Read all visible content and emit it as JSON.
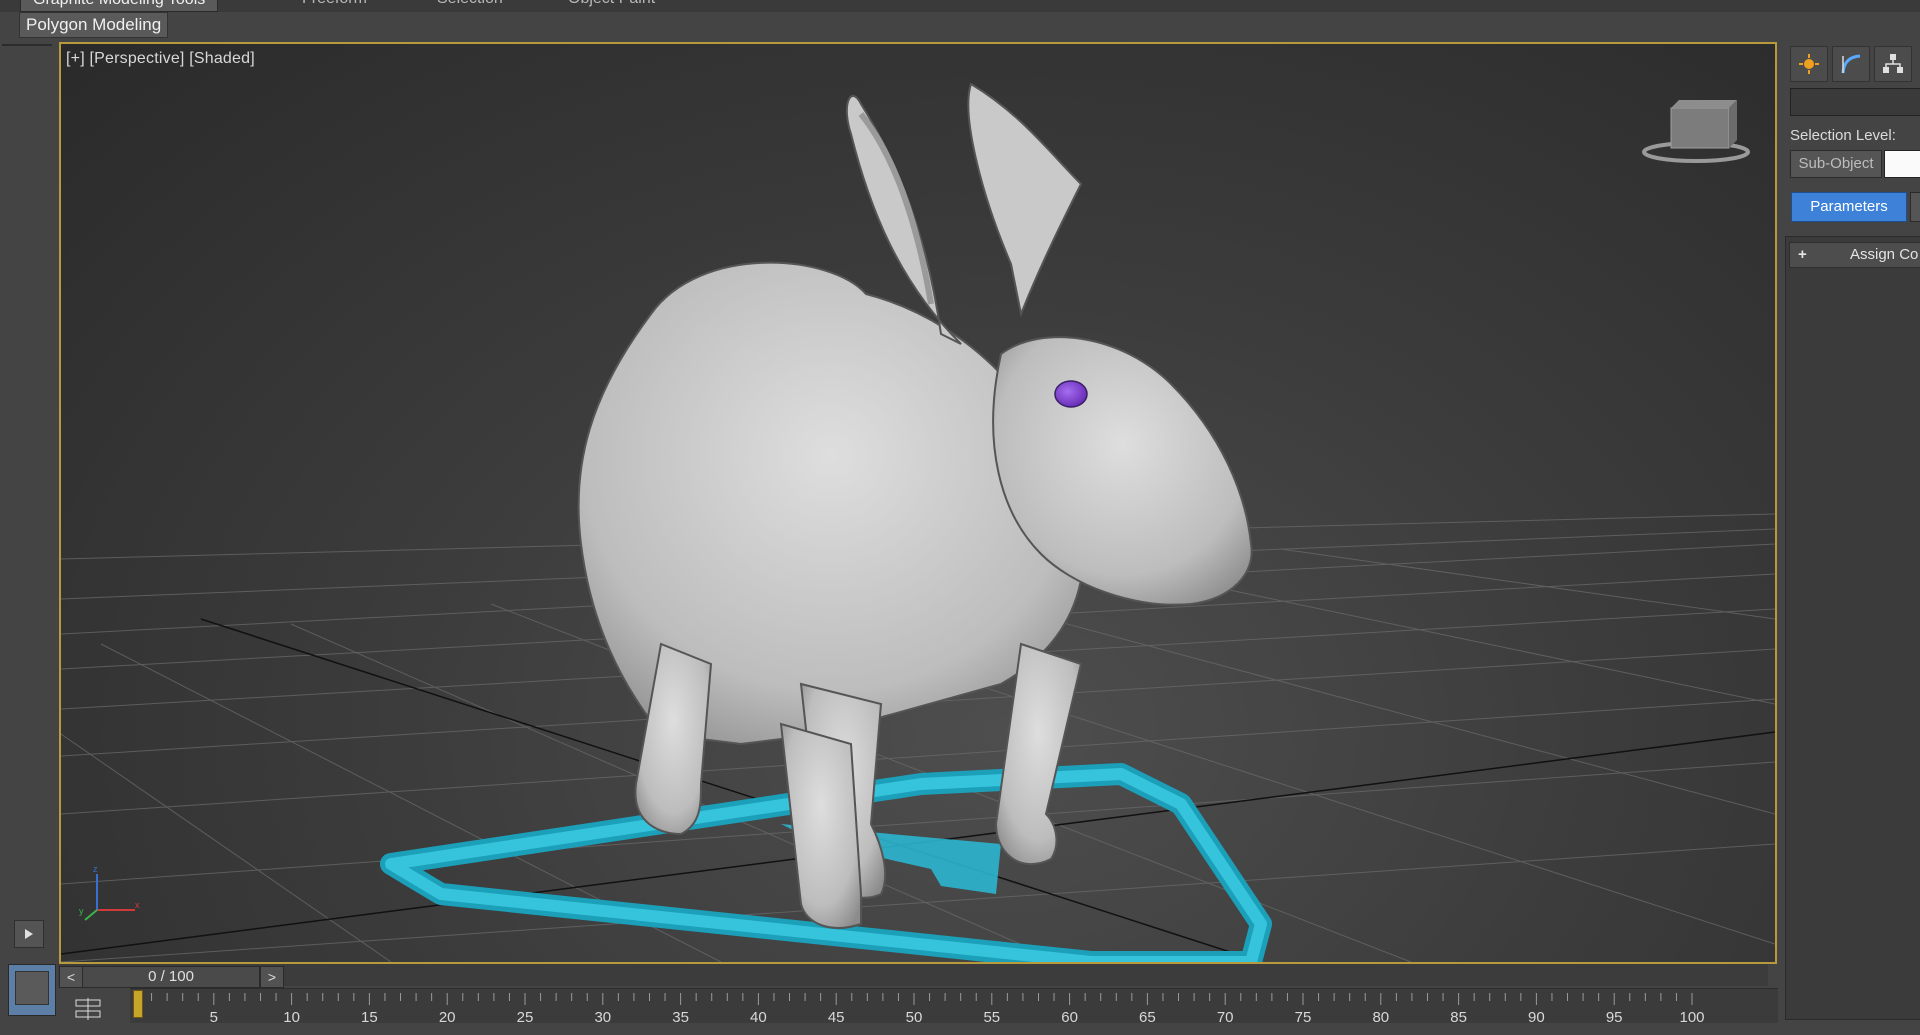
{
  "ribbon": {
    "tabs": [
      {
        "label": "Graphite Modeling Tools",
        "active": true
      },
      {
        "label": "Freeform",
        "active": false
      },
      {
        "label": "Selection",
        "active": false
      },
      {
        "label": "Object Paint",
        "active": false
      }
    ],
    "panel_label": "Polygon Modeling"
  },
  "viewport": {
    "label": "[+] [Perspective] [Shaded]",
    "border_color": "#b79a3c",
    "object": "rabbit",
    "eye_color": "#8a4fd6",
    "helper_color": "#2bb6d0"
  },
  "command_panel": {
    "tab_icons": [
      "sun-icon",
      "curve-icon",
      "hierarchy-icon"
    ],
    "selection_level_label": "Selection Level:",
    "sub_object_label": "Sub-Object",
    "parameters_label": "Parameters",
    "rollout_label": "Assign Co"
  },
  "time_slider": {
    "prev": "<",
    "value": "0 / 100",
    "next": ">"
  },
  "trackbar": {
    "ticks": [
      "5",
      "10",
      "15",
      "20",
      "25",
      "30",
      "35",
      "40",
      "45",
      "50",
      "55",
      "60",
      "65",
      "70",
      "75",
      "80",
      "85",
      "90",
      "95",
      "100"
    ],
    "current_frame": 0
  }
}
